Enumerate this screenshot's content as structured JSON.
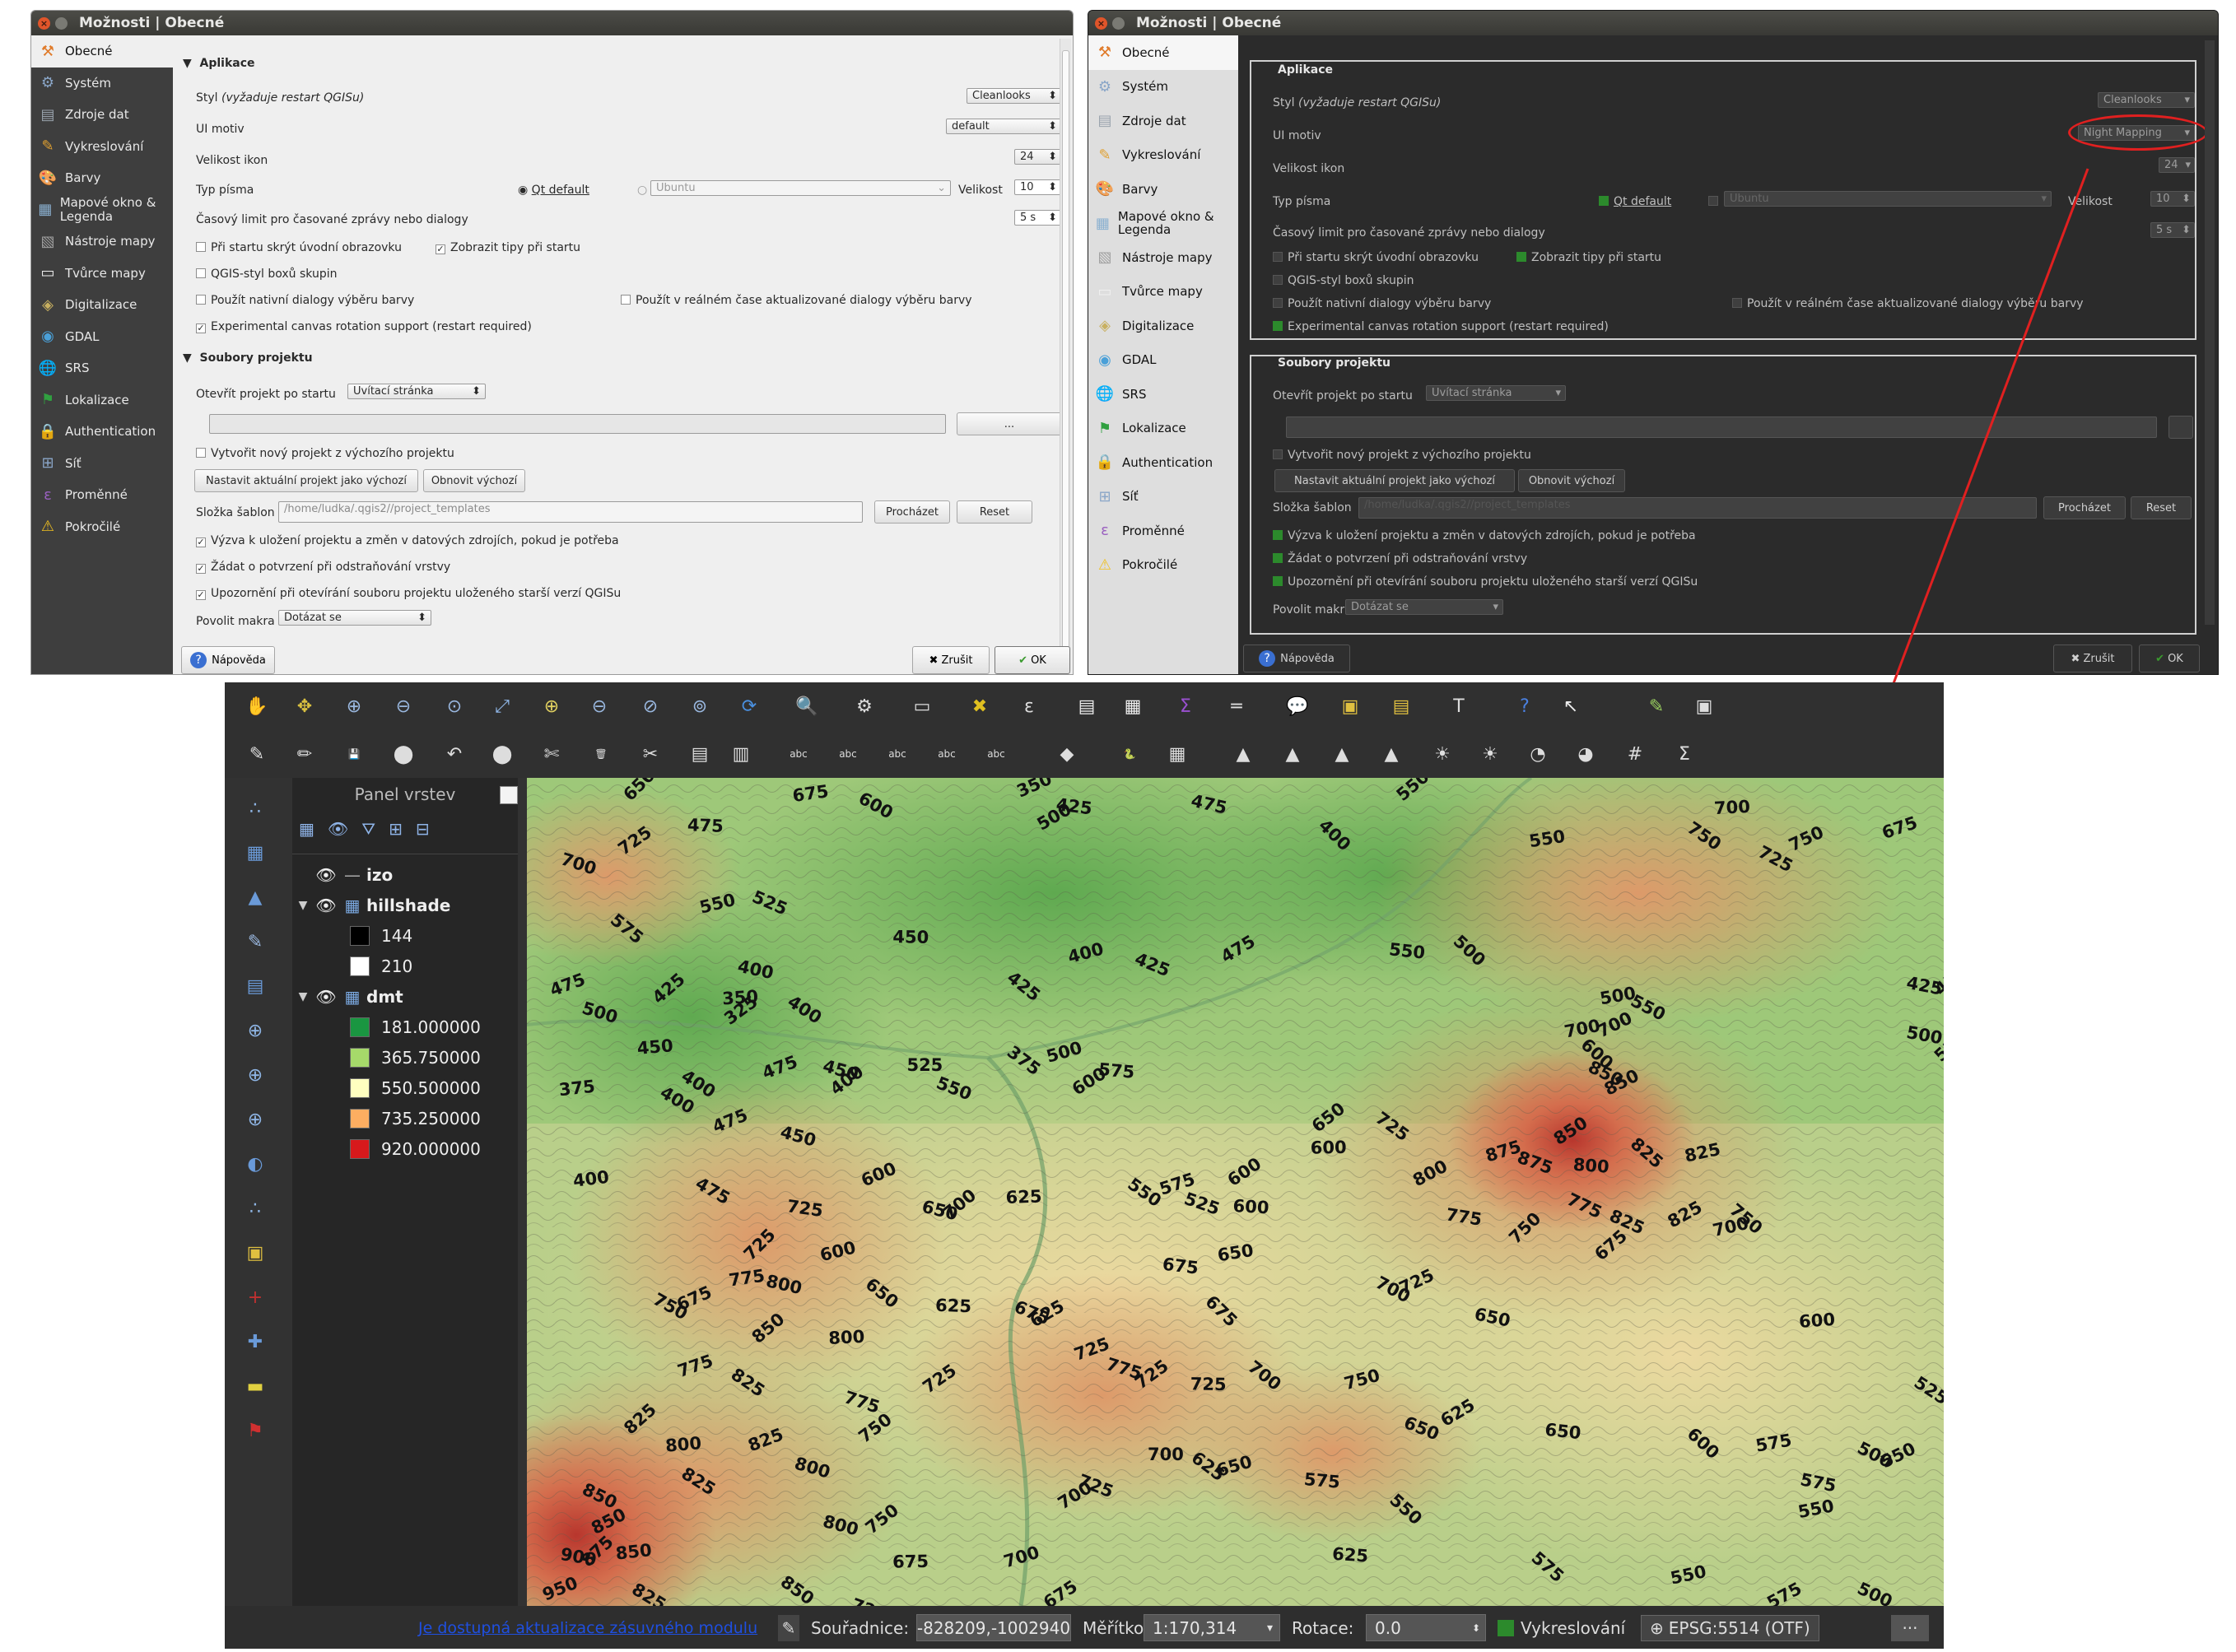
{
  "dialog_title": "Možnosti | Obecné",
  "sidebar": [
    "Obecné",
    "Systém",
    "Zdroje dat",
    "Vykreslování",
    "Barvy",
    "Mapové okno & Legenda",
    "Nástroje mapy",
    "Tvůrce mapy",
    "Digitalizace",
    "GDAL",
    "SRS",
    "Lokalizace",
    "Authentication",
    "Síť",
    "Proměnné",
    "Pokročilé"
  ],
  "app_section": "Aplikace",
  "labels": {
    "style": "Styl",
    "style_note": "(vyžaduje restart QGISu)",
    "ui_theme": "UI motiv",
    "icon_size": "Velikost ikon",
    "font_type": "Typ písma",
    "qt_default": "Qt default",
    "size": "Velikost",
    "timeout": "Časový limit pro časované zprávy nebo dialogy",
    "hide_splash": "Při startu skrýt úvodní obrazovku",
    "show_tips": "Zobrazit tipy při startu",
    "qgis_group": "QGIS-styl boxů skupin",
    "native_color": "Použít nativní dialogy výběru barvy",
    "live_color": "Použít v reálném čase aktualizované dialogy výběru barvy",
    "canvas_rotation": "Experimental canvas rotation support (restart required)",
    "project_section": "Soubory projektu",
    "open_project": "Otevřít projekt po startu",
    "create_default": "Vytvořit nový projekt z výchozího projektu",
    "set_default": "Nastavit aktuální projekt jako výchozí",
    "reset_default": "Obnovit výchozí",
    "templates": "Složka šablon",
    "browse": "Procházet",
    "reset": "Reset",
    "save_prompt": "Výzva k uložení projektu a změn v datových zdrojích, pokud je potřeba",
    "confirm_remove": "Žádat o potvrzení při odstraňování vrstvy",
    "warn_old": "Upozornění při otevírání souboru projektu uloženého starší verzí QGISu",
    "macros": "Povolit makra",
    "help": "Nápověda",
    "cancel": "Zrušit",
    "ok": "OK",
    "browse_small": "..."
  },
  "values_light": {
    "style": "Cleanlooks",
    "ui_theme": "default",
    "icon_size": "24",
    "font": "Ubuntu",
    "font_size": "10",
    "timeout": "5 s",
    "open_project": "Uvítací stránka",
    "templates_path": "/home/ludka/.qgis2//project_templates",
    "macros": "Dotázat se"
  },
  "values_dark": {
    "style": "Cleanlooks",
    "ui_theme": "Night Mapping",
    "icon_size": "24",
    "font": "Ubuntu",
    "font_size": "10",
    "timeout": "5 s",
    "open_project": "Uvítací stránka",
    "templates_path": "/home/ludka/.qgis2//project_templates",
    "macros": "Dotázat se"
  },
  "layers_panel": {
    "title": "Panel vrstev",
    "layers": [
      {
        "name": "izo",
        "type": "line"
      },
      {
        "name": "hillshade",
        "type": "raster",
        "legend": [
          {
            "label": "144",
            "color": "#000000"
          },
          {
            "label": "210",
            "color": "#ffffff"
          }
        ]
      },
      {
        "name": "dmt",
        "type": "raster",
        "legend": [
          {
            "label": "181.000000",
            "color": "#1a9641"
          },
          {
            "label": "365.750000",
            "color": "#a6d96a"
          },
          {
            "label": "550.500000",
            "color": "#ffffc0"
          },
          {
            "label": "735.250000",
            "color": "#fdae61"
          },
          {
            "label": "920.000000",
            "color": "#d7191c"
          }
        ]
      }
    ]
  },
  "status_bar": {
    "plugin_update": "Je dostupná aktualizace zásuvného modulu",
    "coord_label": "Souřadnice:",
    "coord_value": "-828209,-1002940",
    "scale_label": "Měřítko",
    "scale_value": "1:170,314",
    "rotation_label": "Rotace:",
    "rotation_value": "0.0",
    "render_label": "Vykreslování",
    "crs": "EPSG:5514 (OTF)"
  },
  "map_labels": [
    {
      "t": "650",
      "x": 6.5,
      "y": 1.5
    },
    {
      "t": "675",
      "x": 18,
      "y": 1.5
    },
    {
      "t": "600",
      "x": 22.5,
      "y": 1.5
    },
    {
      "t": "350",
      "x": 34,
      "y": 1
    },
    {
      "t": "475",
      "x": 46,
      "y": 2
    },
    {
      "t": "550",
      "x": 61,
      "y": 1.5
    },
    {
      "t": "700",
      "x": 83,
      "y": 3
    },
    {
      "t": "750",
      "x": 81,
      "y": 5
    },
    {
      "t": "675",
      "x": 95,
      "y": 6
    },
    {
      "t": "700",
      "x": 1.5,
      "y": 9
    },
    {
      "t": "725",
      "x": 6,
      "y": 8
    },
    {
      "t": "475",
      "x": 10.5,
      "y": 5
    },
    {
      "t": "575",
      "x": 5,
      "y": 16
    },
    {
      "t": "550",
      "x": 11.5,
      "y": 15
    },
    {
      "t": "525",
      "x": 15,
      "y": 13.5
    },
    {
      "t": "500",
      "x": 35.5,
      "y": 5
    },
    {
      "t": "425",
      "x": 36.5,
      "y": 2.5
    },
    {
      "t": "400",
      "x": 55,
      "y": 4.5
    },
    {
      "t": "550",
      "x": 70,
      "y": 7
    },
    {
      "t": "725",
      "x": 86,
      "y": 8
    },
    {
      "t": "750",
      "x": 88.5,
      "y": 7.5
    },
    {
      "t": "400",
      "x": 14,
      "y": 22
    },
    {
      "t": "425",
      "x": 8.5,
      "y": 26
    },
    {
      "t": "350",
      "x": 13,
      "y": 26
    },
    {
      "t": "400",
      "x": 17.5,
      "y": 26
    },
    {
      "t": "475",
      "x": 1,
      "y": 25
    },
    {
      "t": "500",
      "x": 3,
      "y": 27
    },
    {
      "t": "325",
      "x": 13.5,
      "y": 28.5
    },
    {
      "t": "450",
      "x": 25,
      "y": 18.5
    },
    {
      "t": "425",
      "x": 33,
      "y": 23
    },
    {
      "t": "400",
      "x": 37.5,
      "y": 21
    },
    {
      "t": "425",
      "x": 42,
      "y": 21
    },
    {
      "t": "475",
      "x": 48.5,
      "y": 21
    },
    {
      "t": "550",
      "x": 60,
      "y": 20
    },
    {
      "t": "500",
      "x": 64.5,
      "y": 18.5
    },
    {
      "t": "500",
      "x": 75,
      "y": 26
    },
    {
      "t": "550",
      "x": 77,
      "y": 26
    },
    {
      "t": "700",
      "x": 75,
      "y": 30
    },
    {
      "t": "425",
      "x": 96.5,
      "y": 24
    },
    {
      "t": "450",
      "x": 99,
      "y": 25
    },
    {
      "t": "450",
      "x": 7,
      "y": 32
    },
    {
      "t": "400",
      "x": 10,
      "y": 35
    },
    {
      "t": "475",
      "x": 16,
      "y": 35
    },
    {
      "t": "450",
      "x": 20,
      "y": 34
    },
    {
      "t": "400",
      "x": 21,
      "y": 37
    },
    {
      "t": "525",
      "x": 26,
      "y": 34
    },
    {
      "t": "375",
      "x": 33,
      "y": 32
    },
    {
      "t": "500",
      "x": 36,
      "y": 33
    },
    {
      "t": "550",
      "x": 28,
      "y": 36
    },
    {
      "t": "600",
      "x": 38,
      "y": 37
    },
    {
      "t": "575",
      "x": 39.5,
      "y": 34.5
    },
    {
      "t": "600",
      "x": 73.5,
      "y": 31
    },
    {
      "t": "700",
      "x": 72.5,
      "y": 30
    },
    {
      "t": "850",
      "x": 74,
      "y": 34
    },
    {
      "t": "850",
      "x": 75.5,
      "y": 37
    },
    {
      "t": "500",
      "x": 96.5,
      "y": 30
    },
    {
      "t": "525",
      "x": 99,
      "y": 33
    },
    {
      "t": "375",
      "x": 1.5,
      "y": 37
    },
    {
      "t": "400",
      "x": 8.5,
      "y": 37
    },
    {
      "t": "475",
      "x": 12.5,
      "y": 41.5
    },
    {
      "t": "450",
      "x": 17,
      "y": 42
    },
    {
      "t": "650",
      "x": 55,
      "y": 41.5
    },
    {
      "t": "600",
      "x": 54.5,
      "y": 44
    },
    {
      "t": "725",
      "x": 59,
      "y": 40
    },
    {
      "t": "875",
      "x": 67,
      "y": 45
    },
    {
      "t": "875",
      "x": 69,
      "y": 45
    },
    {
      "t": "850",
      "x": 72,
      "y": 43
    },
    {
      "t": "800",
      "x": 73,
      "y": 46
    },
    {
      "t": "825",
      "x": 77,
      "y": 43
    },
    {
      "t": "825",
      "x": 81,
      "y": 45
    },
    {
      "t": "775",
      "x": 72.5,
      "y": 50
    },
    {
      "t": "800",
      "x": 62,
      "y": 48
    },
    {
      "t": "775",
      "x": 64,
      "y": 52
    },
    {
      "t": "750",
      "x": 69,
      "y": 55
    },
    {
      "t": "400",
      "x": 2.5,
      "y": 48
    },
    {
      "t": "475",
      "x": 11,
      "y": 48
    },
    {
      "t": "600",
      "x": 23,
      "y": 48
    },
    {
      "t": "650",
      "x": 27,
      "y": 51
    },
    {
      "t": "700",
      "x": 29,
      "y": 52
    },
    {
      "t": "625",
      "x": 33,
      "y": 50
    },
    {
      "t": "550",
      "x": 41.5,
      "y": 48
    },
    {
      "t": "575",
      "x": 44,
      "y": 49
    },
    {
      "t": "525",
      "x": 45.5,
      "y": 50
    },
    {
      "t": "600",
      "x": 49,
      "y": 48
    },
    {
      "t": "600",
      "x": 49,
      "y": 51
    },
    {
      "t": "750",
      "x": 84,
      "y": 51
    },
    {
      "t": "700",
      "x": 83,
      "y": 54
    },
    {
      "t": "825",
      "x": 75.5,
      "y": 52
    },
    {
      "t": "825",
      "x": 80,
      "y": 53
    },
    {
      "t": "725",
      "x": 17.5,
      "y": 51
    },
    {
      "t": "725",
      "x": 15,
      "y": 57
    },
    {
      "t": "775",
      "x": 13.5,
      "y": 60
    },
    {
      "t": "750",
      "x": 8,
      "y": 62
    },
    {
      "t": "675",
      "x": 10,
      "y": 63
    },
    {
      "t": "800",
      "x": 16,
      "y": 60
    },
    {
      "t": "850",
      "x": 15.5,
      "y": 67
    },
    {
      "t": "800",
      "x": 20.5,
      "y": 67
    },
    {
      "t": "825",
      "x": 13.5,
      "y": 71
    },
    {
      "t": "775",
      "x": 10,
      "y": 71
    },
    {
      "t": "775",
      "x": 21.5,
      "y": 74
    },
    {
      "t": "725",
      "x": 27.5,
      "y": 73
    },
    {
      "t": "625",
      "x": 28,
      "y": 63
    },
    {
      "t": "650",
      "x": 23,
      "y": 60
    },
    {
      "t": "600",
      "x": 20,
      "y": 57
    },
    {
      "t": "675",
      "x": 33.5,
      "y": 63
    },
    {
      "t": "625",
      "x": 35,
      "y": 65
    },
    {
      "t": "675",
      "x": 44,
      "y": 58
    },
    {
      "t": "675",
      "x": 47,
      "y": 62
    },
    {
      "t": "650",
      "x": 48,
      "y": 57
    },
    {
      "t": "700",
      "x": 59,
      "y": 60
    },
    {
      "t": "725",
      "x": 61,
      "y": 61
    },
    {
      "t": "650",
      "x": 66,
      "y": 64
    },
    {
      "t": "675",
      "x": 75,
      "y": 57
    },
    {
      "t": "600",
      "x": 89,
      "y": 65
    },
    {
      "t": "525",
      "x": 97,
      "y": 72
    },
    {
      "t": "725",
      "x": 38,
      "y": 69
    },
    {
      "t": "775",
      "x": 40,
      "y": 70
    },
    {
      "t": "725",
      "x": 42.5,
      "y": 72.5
    },
    {
      "t": "725",
      "x": 46,
      "y": 72.5
    },
    {
      "t": "700",
      "x": 50,
      "y": 70
    },
    {
      "t": "750",
      "x": 57,
      "y": 72.5
    },
    {
      "t": "650",
      "x": 61,
      "y": 77
    },
    {
      "t": "625",
      "x": 64,
      "y": 77
    },
    {
      "t": "650",
      "x": 71,
      "y": 78
    },
    {
      "t": "600",
      "x": 81,
      "y": 78
    },
    {
      "t": "575",
      "x": 86,
      "y": 80
    },
    {
      "t": "500",
      "x": 93,
      "y": 80
    },
    {
      "t": "550",
      "x": 95,
      "y": 82
    },
    {
      "t": "575",
      "x": 89,
      "y": 84
    },
    {
      "t": "825",
      "x": 6.5,
      "y": 78
    },
    {
      "t": "800",
      "x": 9,
      "y": 80
    },
    {
      "t": "825",
      "x": 10,
      "y": 83
    },
    {
      "t": "825",
      "x": 15,
      "y": 80
    },
    {
      "t": "800",
      "x": 18,
      "y": 82
    },
    {
      "t": "750",
      "x": 23,
      "y": 79
    },
    {
      "t": "700",
      "x": 43,
      "y": 81
    },
    {
      "t": "625",
      "x": 46,
      "y": 81
    },
    {
      "t": "650",
      "x": 48,
      "y": 83
    },
    {
      "t": "725",
      "x": 38,
      "y": 84
    },
    {
      "t": "700",
      "x": 37,
      "y": 87
    },
    {
      "t": "575",
      "x": 54,
      "y": 84
    },
    {
      "t": "550",
      "x": 60,
      "y": 86
    },
    {
      "t": "550",
      "x": 89,
      "y": 88
    },
    {
      "t": "850",
      "x": 3,
      "y": 85
    },
    {
      "t": "850",
      "x": 4,
      "y": 90
    },
    {
      "t": "900",
      "x": 1.5,
      "y": 93
    },
    {
      "t": "875",
      "x": 3.5,
      "y": 94
    },
    {
      "t": "850",
      "x": 5.5,
      "y": 93
    },
    {
      "t": "825",
      "x": 6.5,
      "y": 97
    },
    {
      "t": "950",
      "x": 0.5,
      "y": 98
    },
    {
      "t": "800",
      "x": 20,
      "y": 89
    },
    {
      "t": "750",
      "x": 23.5,
      "y": 90
    },
    {
      "t": "675",
      "x": 25,
      "y": 94
    },
    {
      "t": "850",
      "x": 17,
      "y": 96
    },
    {
      "t": "700",
      "x": 33,
      "y": 94
    },
    {
      "t": "725",
      "x": 22,
      "y": 99
    },
    {
      "t": "675",
      "x": 36,
      "y": 99
    },
    {
      "t": "625",
      "x": 56,
      "y": 93
    },
    {
      "t": "575",
      "x": 70,
      "y": 93
    },
    {
      "t": "550",
      "x": 80,
      "y": 96
    },
    {
      "t": "500",
      "x": 93,
      "y": 97
    },
    {
      "t": "575",
      "x": 87,
      "y": 99
    }
  ]
}
